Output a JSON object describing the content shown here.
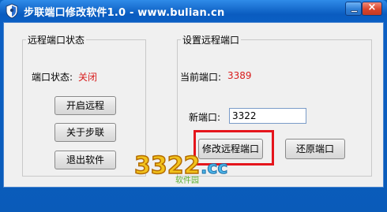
{
  "window": {
    "title": "步联端口修改软件1.0 - www.bulian.cn",
    "minimize_label": "",
    "close_label": "×"
  },
  "left_group": {
    "legend": "远程端口状态",
    "status_label": "端口状态:",
    "status_value": "关闭",
    "buttons": {
      "start_remote": "开启远程",
      "about": "关于步联",
      "exit": "退出软件"
    }
  },
  "right_group": {
    "legend": "设置远程端口",
    "current_port_label": "当前端口:",
    "current_port_value": "3389",
    "new_port_label": "新端口:",
    "new_port_value": "3322",
    "buttons": {
      "modify": "修改远程端口",
      "restore": "还原端口"
    }
  },
  "watermark": {
    "text": "3322.cc",
    "subtext": "软件园"
  },
  "colors": {
    "title_blue": "#0b5fc4",
    "status_red": "#d81d1d",
    "highlight_red": "#e5151c"
  }
}
